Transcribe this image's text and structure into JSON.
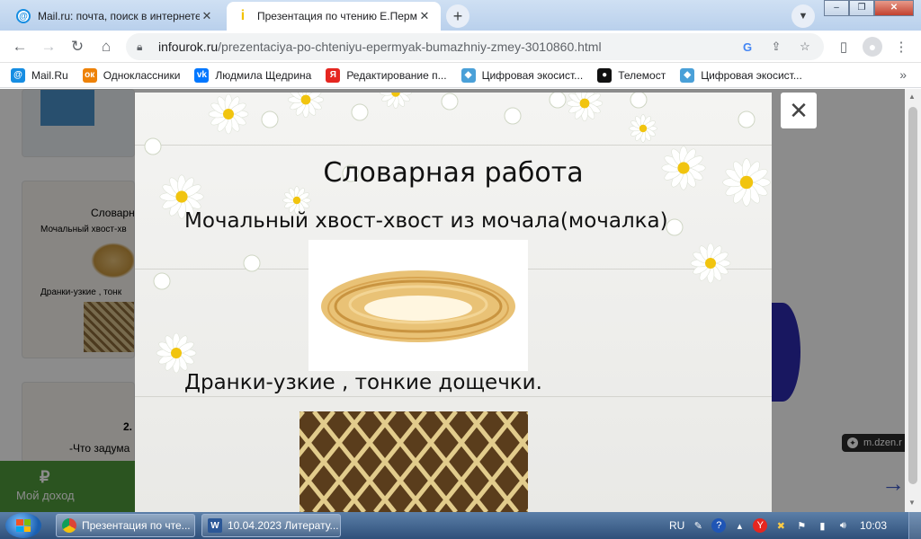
{
  "tabs": [
    {
      "title": "Mail.ru: почта, поиск в интернете",
      "icon": "mailru-icon",
      "active": false
    },
    {
      "title": "Презентация по чтению Е.Пермяк",
      "icon": "infourok-icon",
      "active": true
    }
  ],
  "toolbar": {
    "url_host": "infourok.ru",
    "url_path": "/prezentaciya-po-chteniyu-epermyak-bumazhniy-zmey-3010860.html"
  },
  "bookmarks": [
    {
      "label": "Mail.Ru",
      "color": "#168de2",
      "glyph": "@"
    },
    {
      "label": "Одноклассники",
      "color": "#ee8208",
      "glyph": "ок"
    },
    {
      "label": "Людмила Щедрина",
      "color": "#0077ff",
      "glyph": "vk"
    },
    {
      "label": "Редактирование п...",
      "color": "#e52620",
      "glyph": "Я"
    },
    {
      "label": "Цифровая экосист...",
      "color": "#4aa0d8",
      "glyph": "◆"
    },
    {
      "label": "Телемост",
      "color": "#111111",
      "glyph": "●"
    },
    {
      "label": "Цифровая экосист...",
      "color": "#4aa0d8",
      "glyph": "◆"
    }
  ],
  "slide": {
    "title": "Словарная  работа",
    "line1": "Мочальный хвост-хвост из мочала(мочалка)",
    "line2": "Дранки-узкие , тонкие дощечки."
  },
  "background_cards": [
    {
      "title": "Словарная",
      "line1": "Мочальный хвост-хв",
      "line2": "Дранки-узкие , тонк"
    },
    {
      "title": "2.",
      "line1": "-Что задума",
      "line2": ""
    }
  ],
  "page": {
    "income_symbol": "₽",
    "income_label": "Мой доход",
    "dzen_label": "m.dzen.r"
  },
  "taskbar": {
    "tasks": [
      {
        "label": "Презентация по чте..."
      },
      {
        "label": "10.04.2023 Литерату..."
      }
    ],
    "lang": "RU",
    "clock": "10:03"
  }
}
